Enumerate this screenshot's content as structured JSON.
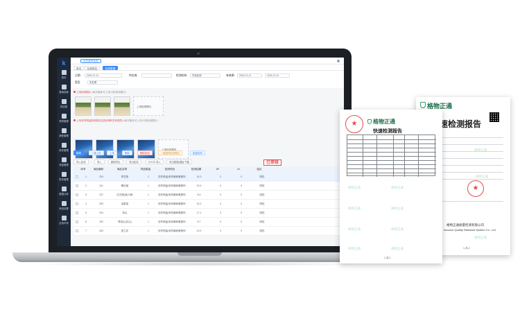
{
  "app": {
    "top_tag": "全氏食药检测",
    "tabs": [
      "首页",
      "检测报告",
      "检测数据"
    ],
    "nav": [
      {
        "label": "首页",
        "icon": "home-icon"
      },
      {
        "label": "基础档案",
        "icon": "folder-icon"
      },
      {
        "label": "供应链",
        "icon": "link-icon"
      },
      {
        "label": "采购管理",
        "icon": "cart-icon"
      },
      {
        "label": "销售管理",
        "icon": "truck-icon"
      },
      {
        "label": "库存管理",
        "icon": "box-icon"
      },
      {
        "label": "资金管理",
        "icon": "wallet-icon"
      },
      {
        "label": "财务管理",
        "icon": "ledger-icon"
      },
      {
        "label": "数据分析",
        "icon": "chart-icon"
      },
      {
        "label": "系统设置",
        "icon": "gear-icon"
      },
      {
        "label": "应用市场",
        "icon": "apps-icon"
      }
    ]
  },
  "filter": {
    "date_label": "日期:",
    "date_from": "2024-12-11",
    "date_to": "2024-12-11",
    "supplier_label": "供应商:",
    "supplier_value": "",
    "org_label": "检测机构:",
    "org_value": "华检检测",
    "time_label": "有效期:",
    "time_from": "2024-12-11",
    "time_to": "2024-12-11",
    "status_label": "是否",
    "status_value": "未处理"
  },
  "notices": [
    {
      "highlight": "上传检测照片",
      "hint": "(每次最多可上传10张检测照片)"
    },
    {
      "highlight": "上传农药残留检测报告(如检测单位有资质)",
      "hint": "(每次最多可上传10张检测图片)"
    }
  ],
  "upload_labels": [
    "上传检测照片",
    "上传检测报告"
  ],
  "toolbar": {
    "buttons": [
      "新增",
      "一键上传",
      "上传",
      "删除",
      "删除检测",
      "一键选择检测单位",
      "批量检测"
    ],
    "buttons2": [
      "导入检测",
      "导入",
      "删除导出",
      "导出检测",
      "EXCEL导入",
      "导出数据(模板下载)"
    ],
    "review_stamp": "已审核"
  },
  "table": {
    "headers": [
      "序号",
      "商品编码",
      "商品名称",
      "样品数量",
      "检测项目",
      "检测结果",
      "AF",
      "AI",
      "结论"
    ],
    "rows": [
      [
        "1",
        "333",
        "青豆角",
        "1",
        "农药残留(有机磷和氨基甲...)",
        "16.3",
        "0",
        "0",
        "阴性"
      ],
      [
        "2",
        "311",
        "螺丝椒",
        "1",
        "农药残留(有机磷和氨基甲...)",
        "22.9",
        "0",
        "0",
        "阴性"
      ],
      [
        "3",
        "237",
        "红花椒(湘人辣)",
        "1",
        "农药残留(有机磷和氨基甲...)",
        "8.9",
        "0",
        "0",
        "阴性"
      ],
      [
        "4",
        "283",
        "油麦菜",
        "1",
        "农药残留(有机磷和氨基甲...)",
        "16.3",
        "0",
        "0",
        "阴性"
      ],
      [
        "5",
        "294",
        "茶瓜",
        "1",
        "农药残留(有机磷和氨基甲...)",
        "17.1",
        "0",
        "0",
        "阴性"
      ],
      [
        "6",
        "292",
        "青线瓜(花瓜)",
        "1",
        "农药残留(有机磷和氨基甲...)",
        "8.7",
        "0",
        "0",
        "阴性"
      ],
      [
        "7",
        "263",
        "西兰花",
        "1",
        "农药残留(有机磷和氨基甲...)",
        "13.3",
        "0",
        "0",
        "阴性"
      ]
    ]
  },
  "docs": {
    "brand": "格物正通",
    "doc1_title": "快速检测报告",
    "doc2_title": "速检测报告",
    "doc2_footer": "格物正通质量检测有限公司",
    "doc2_footer_en": "esource Quality Standard System Co., Ltd.",
    "watermark": "格物正通",
    "page_no": "1-共-1"
  }
}
